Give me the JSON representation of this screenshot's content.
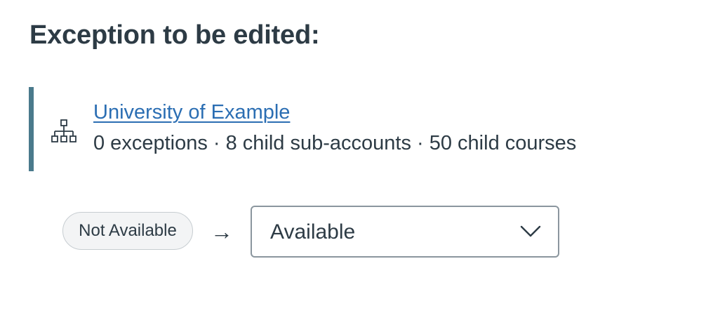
{
  "heading": "Exception to be edited:",
  "account": {
    "name": "University of Example",
    "meta": "0 exceptions · 8 child sub-accounts · 50 child courses",
    "icon": "hierarchy-icon",
    "accent_color": "#4a7a8c",
    "link_color": "#2b6eb3"
  },
  "exception": {
    "current_status": "Not Available",
    "arrow": "→",
    "selected_value": "Available",
    "dropdown_icon": "chevron-down-icon"
  }
}
